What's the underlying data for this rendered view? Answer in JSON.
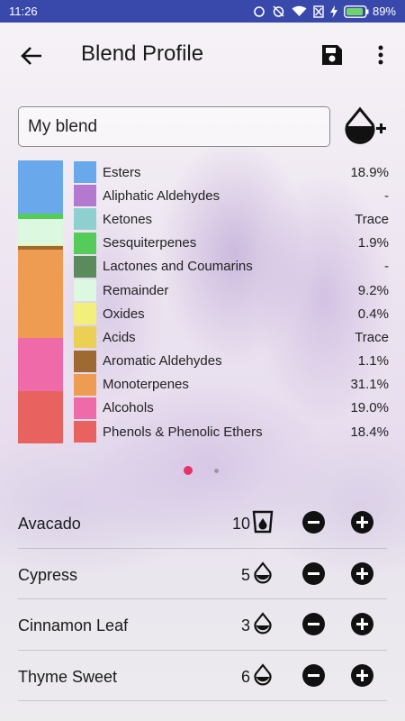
{
  "status_bar": {
    "time": "11:26",
    "battery_percent": "89%",
    "icons": [
      "sync-icon",
      "alarm-off-icon",
      "wifi-icon",
      "no-sim-icon",
      "charging-icon",
      "battery-icon"
    ]
  },
  "app_bar": {
    "title": "Blend Profile",
    "icons": [
      "back-arrow-icon",
      "save-icon",
      "more-vert-icon"
    ]
  },
  "blend": {
    "name": "My blend",
    "add_oil_icon": "add-drop-icon"
  },
  "composition": {
    "stack": [
      {
        "label": "Esters",
        "color": "#6aa8ec",
        "fraction": 0.189
      },
      {
        "label": "Sesquiterpenes",
        "color": "#55cc5a",
        "fraction": 0.019
      },
      {
        "label": "Remainder",
        "color": "#dcf8e0",
        "fraction": 0.092
      },
      {
        "label": "Oxides",
        "color": "#f2f07a",
        "fraction": 0.004
      },
      {
        "label": "Aromatic Aldehydes",
        "color": "#9e6a32",
        "fraction": 0.011
      },
      {
        "label": "Monoterpenes",
        "color": "#ee9c52",
        "fraction": 0.311
      },
      {
        "label": "Alcohols",
        "color": "#ef6aa8",
        "fraction": 0.19
      },
      {
        "label": "Phenols & Phenolic Ethers",
        "color": "#e8625f",
        "fraction": 0.184
      }
    ],
    "legend": [
      {
        "label": "Esters",
        "value": "18.9%",
        "color": "#6aa8ec"
      },
      {
        "label": "Aliphatic Aldehydes",
        "value": "-",
        "color": "#b378cf"
      },
      {
        "label": "Ketones",
        "value": "Trace",
        "color": "#8ed0d0"
      },
      {
        "label": "Sesquiterpenes",
        "value": "1.9%",
        "color": "#55cc5a"
      },
      {
        "label": "Lactones and Coumarins",
        "value": "-",
        "color": "#5b8a5c"
      },
      {
        "label": "Remainder",
        "value": "9.2%",
        "color": "#dcf8e0"
      },
      {
        "label": "Oxides",
        "value": "0.4%",
        "color": "#f2f07a"
      },
      {
        "label": "Acids",
        "value": "Trace",
        "color": "#ecd054"
      },
      {
        "label": "Aromatic Aldehydes",
        "value": "1.1%",
        "color": "#9e6a32"
      },
      {
        "label": "Monoterpenes",
        "value": "31.1%",
        "color": "#ee9c52"
      },
      {
        "label": "Alcohols",
        "value": "19.0%",
        "color": "#ef6aa8"
      },
      {
        "label": "Phenols & Phenolic Ethers",
        "value": "18.4%",
        "color": "#e8625f"
      }
    ],
    "page_indicator": {
      "pages": 2,
      "current": 1,
      "active_color": "#e8336a"
    }
  },
  "oils": [
    {
      "name": "Avacado",
      "qty": "10",
      "unit_icon": "cup-icon"
    },
    {
      "name": "Cypress",
      "qty": "5",
      "unit_icon": "drop-icon"
    },
    {
      "name": "Cinnamon Leaf",
      "qty": "3",
      "unit_icon": "drop-icon"
    },
    {
      "name": "Thyme Sweet",
      "qty": "6",
      "unit_icon": "drop-icon"
    }
  ],
  "colors": {
    "status_bar": "#3949ab",
    "accent": "#e8336a"
  }
}
